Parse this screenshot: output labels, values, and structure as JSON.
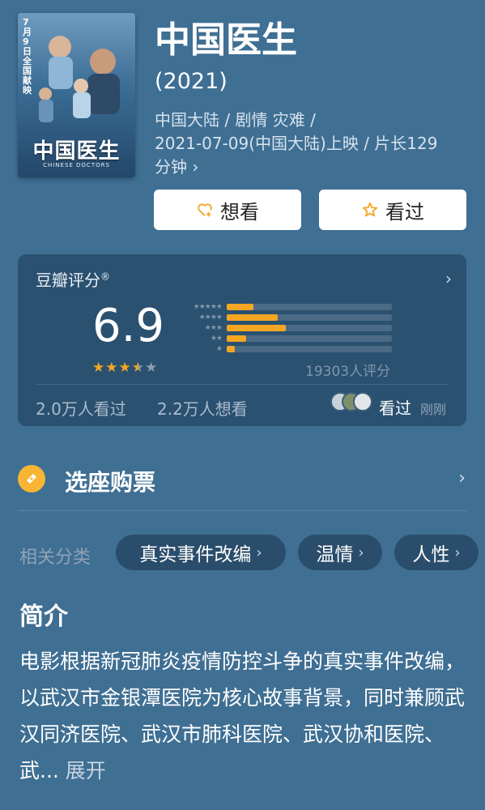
{
  "poster": {
    "date_text": "7月9日 全国献映",
    "title": "中国医生",
    "subtitle": "CHINESE DOCTORS"
  },
  "movie": {
    "title": "中国医生",
    "year": "(2021)",
    "meta_line1": "中国大陆 / 剧情 灾难 /",
    "meta_line2": "2021-07-09(中国大陆)上映 / 片长129",
    "meta_line3": "分钟 ›"
  },
  "actions": {
    "want_label": "想看",
    "seen_label": "看过"
  },
  "rating": {
    "label": "豆瓣评分",
    "reg_mark": "®",
    "score": "6.9",
    "score_value": 6.9,
    "stars_filled": 3.5,
    "distribution": [
      {
        "stars": 5,
        "fraction": 0.16
      },
      {
        "stars": 4,
        "fraction": 0.31
      },
      {
        "stars": 3,
        "fraction": 0.36
      },
      {
        "stars": 2,
        "fraction": 0.12
      },
      {
        "stars": 1,
        "fraction": 0.05
      }
    ],
    "count_text": "19303人评分",
    "watched_text": "2.0万人看过",
    "wish_text": "2.2万人想看",
    "friend_status": "看过",
    "friend_time": "刚刚"
  },
  "ticket": {
    "label": "选座购票"
  },
  "tags": {
    "label": "相关分类",
    "items": [
      "真实事件改编",
      "温情",
      "人性"
    ]
  },
  "synopsis": {
    "title": "简介",
    "text": "电影根据新冠肺炎疫情防控斗争的真实事件改编，以武汉市金银潭医院为核心故事背景，同时兼顾武汉同济医院、武汉市肺科医院、武汉协和医院、武...",
    "expand_label": "展开"
  },
  "colors": {
    "background": "#3f6f93",
    "accent": "#f5a623",
    "star": "#f5a623",
    "ticket_icon": "#f7b533"
  }
}
